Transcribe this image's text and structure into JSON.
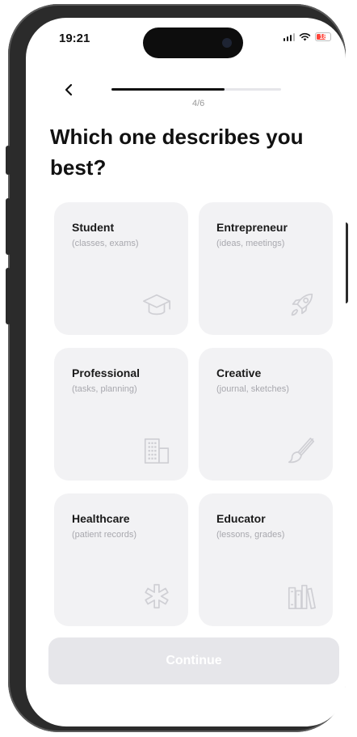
{
  "status_bar": {
    "time": "19:21",
    "battery": "18",
    "battery_color": "#ff453a",
    "icons": [
      "signal-icon",
      "wifi-icon",
      "battery-icon"
    ]
  },
  "header": {
    "back_icon": "chevron-left-icon",
    "step": "4/6",
    "progress": 0.6667
  },
  "title": "Which one describes you best?",
  "options": [
    {
      "label": "Student",
      "subtitle": "(classes, exams)",
      "icon": "graduation-cap-icon"
    },
    {
      "label": "Entrepreneur",
      "subtitle": "(ideas, meetings)",
      "icon": "rocket-icon"
    },
    {
      "label": "Professional",
      "subtitle": "(tasks, planning)",
      "icon": "building-icon"
    },
    {
      "label": "Creative",
      "subtitle": "(journal, sketches)",
      "icon": "paintbrush-icon"
    },
    {
      "label": "Healthcare",
      "subtitle": "(patient records)",
      "icon": "medical-asterisk-icon"
    },
    {
      "label": "Educator",
      "subtitle": "(lessons, grades)",
      "icon": "books-icon"
    }
  ],
  "continue_label": "Continue",
  "colors": {
    "card_background": "#f2f2f4",
    "button_disabled": "#e6e6ea",
    "text_primary": "#111111",
    "text_muted": "#a8a8ae"
  }
}
